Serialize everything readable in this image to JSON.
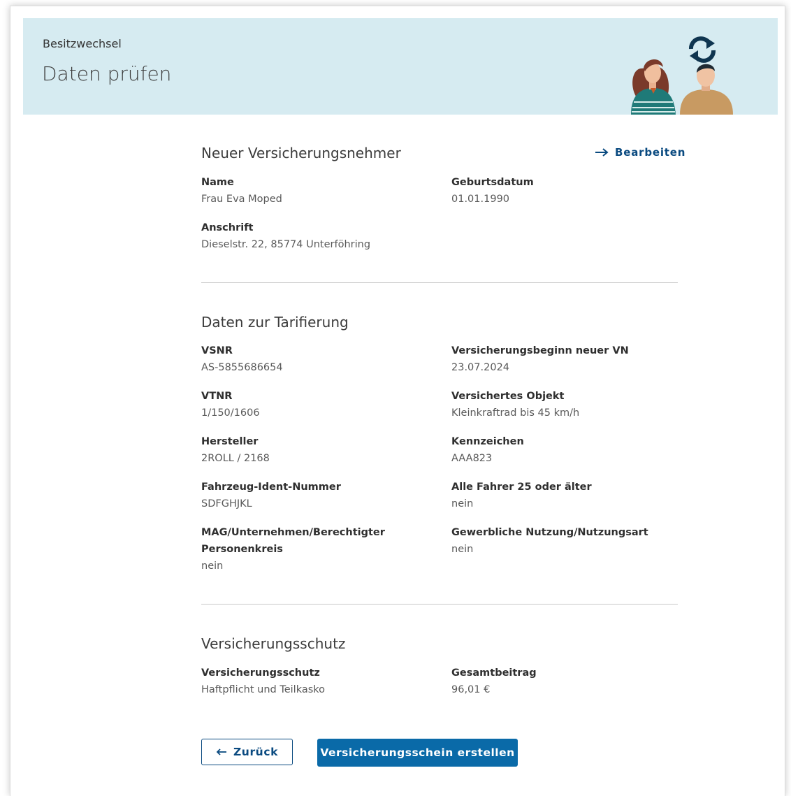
{
  "header": {
    "breadcrumb": "Besitzwechsel",
    "title": "Daten prüfen"
  },
  "section_holder": {
    "title": "Neuer Versicherungsnehmer",
    "edit_label": "Bearbeiten",
    "name_label": "Name",
    "name_value": "Frau Eva Moped",
    "dob_label": "Geburtsdatum",
    "dob_value": "01.01.1990",
    "address_label": "Anschrift",
    "address_value": "Dieselstr. 22, 85774 Unterföhring"
  },
  "section_tariff": {
    "title": "Daten zur Tarifierung",
    "fields": [
      {
        "label": "VSNR",
        "value": "AS-5855686654"
      },
      {
        "label": "Versicherungsbeginn neuer VN",
        "value": "23.07.2024"
      },
      {
        "label": "VTNR",
        "value": "1/150/1606"
      },
      {
        "label": "Versichertes Objekt",
        "value": "Kleinkraftrad bis 45 km/h"
      },
      {
        "label": "Hersteller",
        "value": "2ROLL / 2168"
      },
      {
        "label": "Kennzeichen",
        "value": "AAA823"
      },
      {
        "label": "Fahrzeug-Ident-Nummer",
        "value": "SDFGHJKL"
      },
      {
        "label": "Alle Fahrer 25 oder älter",
        "value": "nein"
      },
      {
        "label": "MAG/Unternehmen/Berechtigter",
        "label2": "Personenkreis",
        "value": "nein"
      },
      {
        "label": "Gewerbliche Nutzung/Nutzungsart",
        "value": "nein"
      }
    ]
  },
  "section_coverage": {
    "title": "Versicherungsschutz",
    "coverage_label": "Versicherungsschutz",
    "coverage_value": "Haftpflicht und Teilkasko",
    "total_label": "Gesamtbeitrag",
    "total_value": "96,01 €"
  },
  "actions": {
    "back_label": "Zurück",
    "submit_label": "Versicherungsschein erstellen"
  },
  "colors": {
    "banner_bg": "#d6ebf1",
    "primary": "#0a6aa8",
    "link": "#0a4a80"
  },
  "icons": [
    "refresh-icon",
    "arrow-right-icon",
    "arrow-left-icon"
  ]
}
